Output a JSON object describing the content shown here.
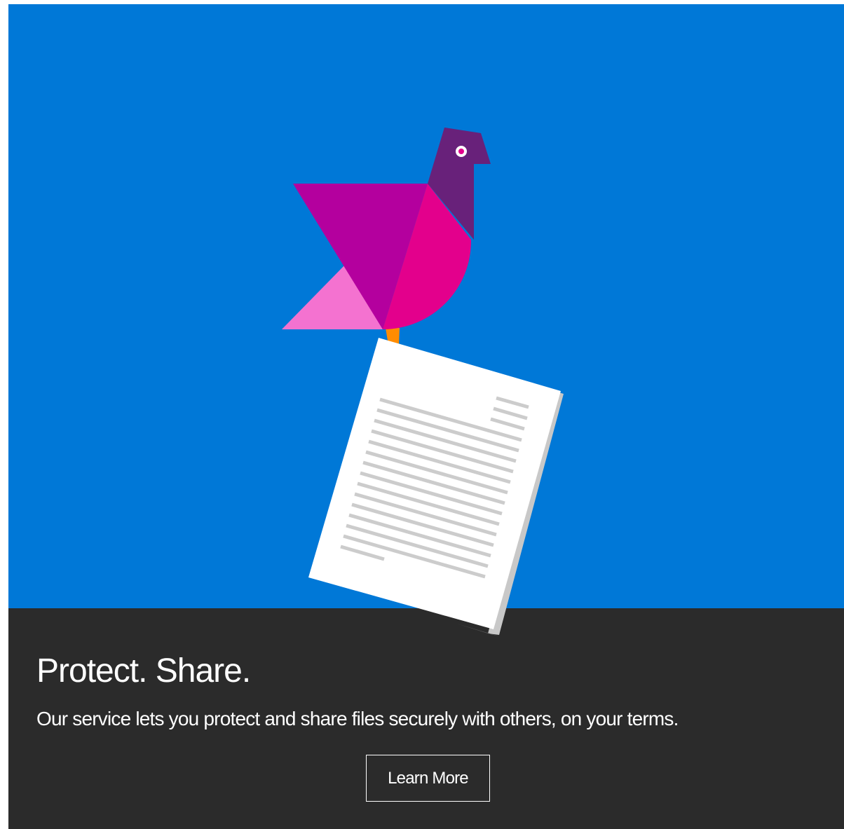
{
  "colors": {
    "hero_background": "#0078d7",
    "footer_background": "#2b2b2b",
    "text": "#ffffff",
    "bird_wing": "#b4009e",
    "bird_chest": "#e3008c",
    "bird_tail": "#f472d0",
    "bird_head": "#68217a",
    "bird_foot": "#ff8c00",
    "paper": "#ffffff",
    "paper_lines": "#cccccc"
  },
  "illustration": {
    "icons": [
      "bird-icon",
      "document-icon"
    ]
  },
  "content": {
    "headline": "Protect. Share.",
    "tagline": "Our service lets you protect and share files securely with others, on your terms.",
    "learn_more_label": "Learn More"
  }
}
